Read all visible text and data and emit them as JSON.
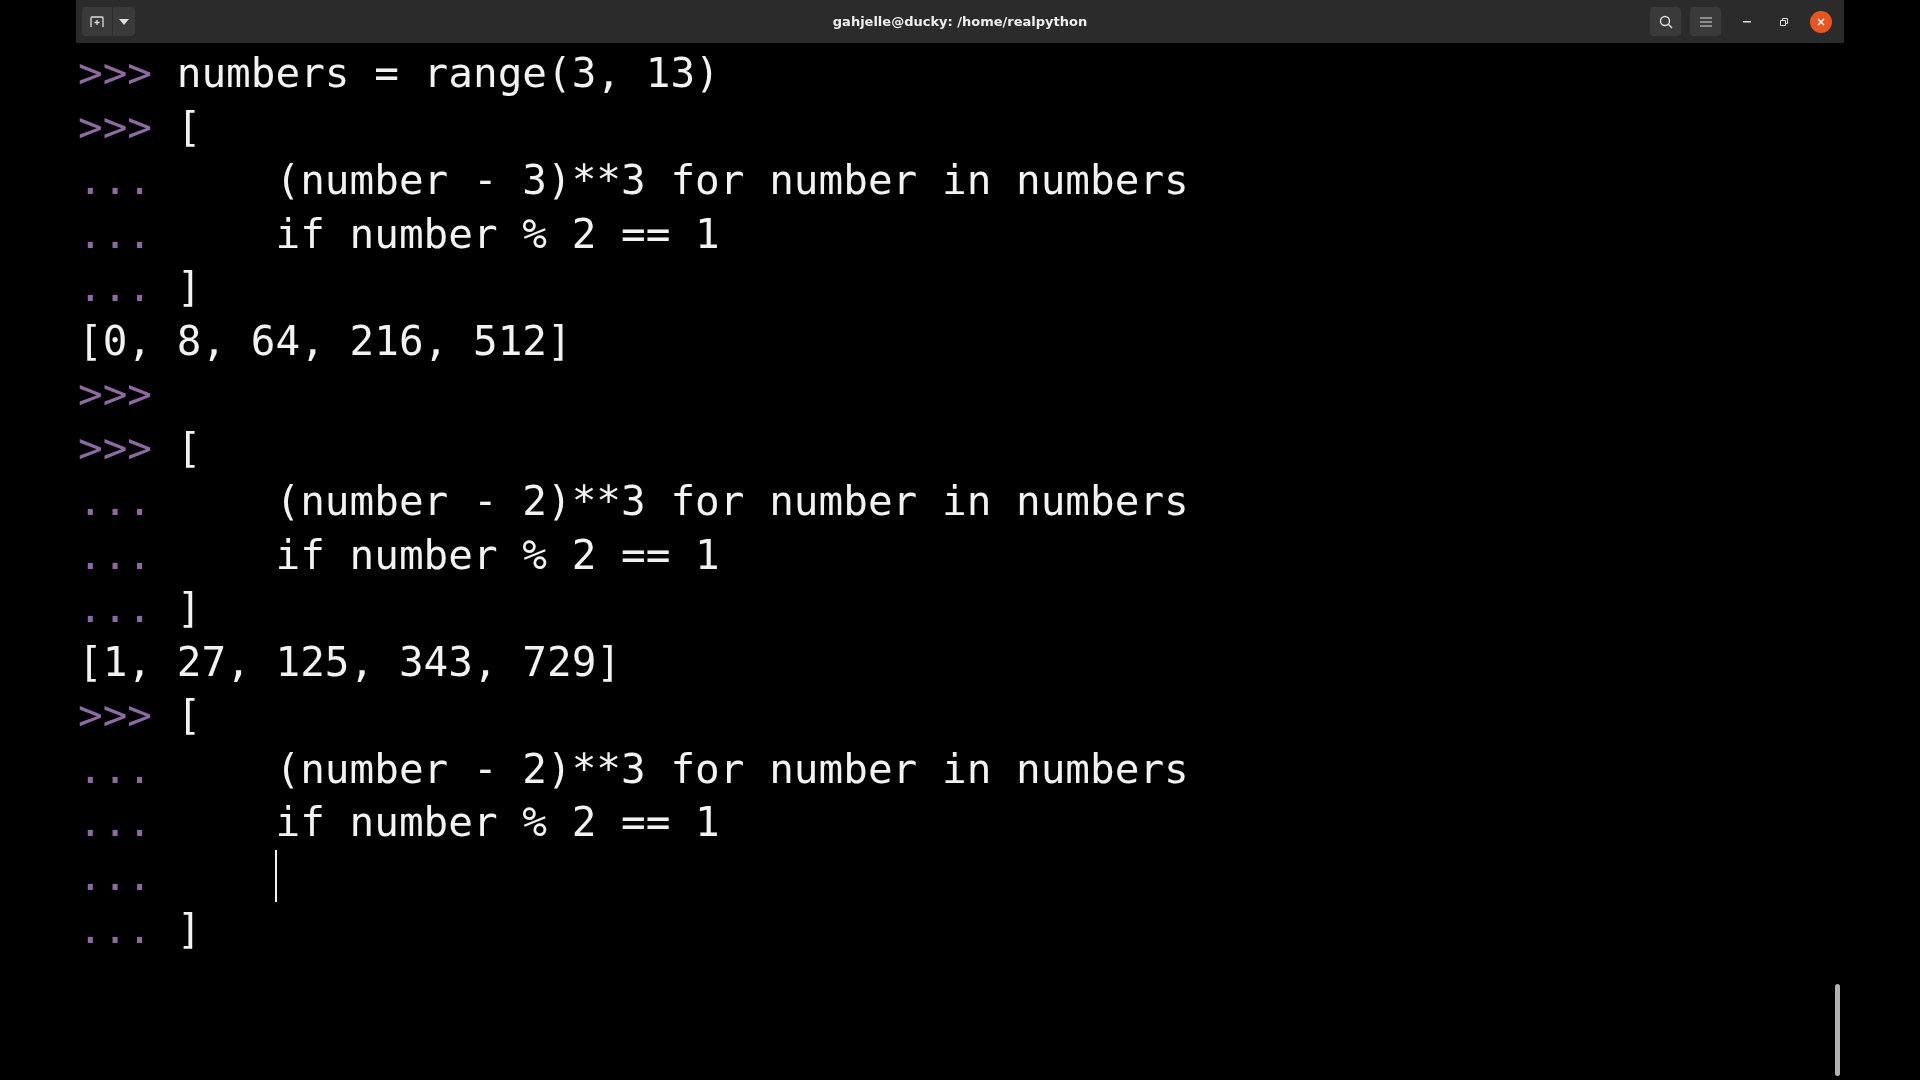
{
  "window": {
    "title": "gahjelle@ducky: /home/realpython"
  },
  "lines": [
    {
      "prompt": ">>>",
      "code": "numbers = range(3, 13)"
    },
    {
      "prompt": ">>>",
      "code": "["
    },
    {
      "prompt": "...",
      "code": "    (number - 3)**3 for number in numbers"
    },
    {
      "prompt": "...",
      "code": "    if number % 2 == 1"
    },
    {
      "prompt": "...",
      "code": "]"
    },
    {
      "output": "[0, 8, 64, 216, 512]"
    },
    {
      "prompt": ">>>"
    },
    {
      "prompt": ">>>",
      "code": "["
    },
    {
      "prompt": "...",
      "code": "    (number - 2)**3 for number in numbers"
    },
    {
      "prompt": "...",
      "code": "    if number % 2 == 1"
    },
    {
      "prompt": "...",
      "code": "]"
    },
    {
      "output": "[1, 27, 125, 343, 729]"
    },
    {
      "prompt": ">>>",
      "code": "["
    },
    {
      "prompt": "...",
      "code": "    (number - 2)**3 for number in numbers"
    },
    {
      "prompt": "...",
      "code": "    if number % 2 == 1"
    },
    {
      "prompt": "...",
      "cursor": true
    },
    {
      "prompt": "...",
      "code": "]"
    }
  ]
}
